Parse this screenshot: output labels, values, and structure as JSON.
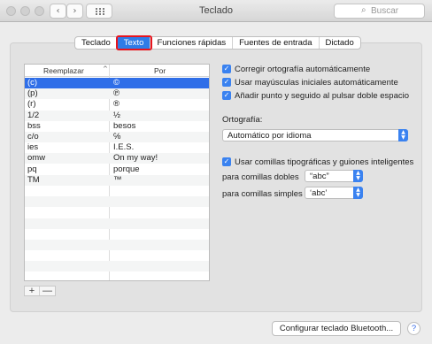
{
  "window": {
    "title": "Teclado",
    "back_glyph": "‹",
    "forward_glyph": "›",
    "search_icon_glyph": "⌕",
    "search_placeholder": "Buscar"
  },
  "tabs": [
    {
      "label": "Teclado",
      "selected": false
    },
    {
      "label": "Texto",
      "selected": true
    },
    {
      "label": "Funciones rápidas",
      "selected": false
    },
    {
      "label": "Fuentes de entrada",
      "selected": false
    },
    {
      "label": "Dictado",
      "selected": false
    }
  ],
  "table": {
    "col_replace": "Reemplazar",
    "col_with": "Por",
    "sort_glyph": "^",
    "rows": [
      {
        "replace": "(c)",
        "with": "©"
      },
      {
        "replace": "(p)",
        "with": "℗"
      },
      {
        "replace": "(r)",
        "with": "®"
      },
      {
        "replace": "1/2",
        "with": "½"
      },
      {
        "replace": "bss",
        "with": "besos"
      },
      {
        "replace": "c/o",
        "with": "℅"
      },
      {
        "replace": "ies",
        "with": "I.E.S."
      },
      {
        "replace": "omw",
        "with": "On my way!"
      },
      {
        "replace": "pq",
        "with": "porque"
      },
      {
        "replace": "TM",
        "with": "™"
      }
    ],
    "add_label": "+",
    "remove_label": "—"
  },
  "options": {
    "spelling_correct": {
      "label": "Corregir ortografía automáticamente",
      "checked": true
    },
    "capitalize": {
      "label": "Usar mayúsculas iniciales automáticamente",
      "checked": true
    },
    "period_double_space": {
      "label": "Añadir punto y seguido al pulsar doble espacio",
      "checked": true
    },
    "smart_quotes": {
      "label": "Usar comillas tipográficas y guiones inteligentes",
      "checked": true
    },
    "check_glyph": "✓"
  },
  "spelling": {
    "label": "Ortografía:",
    "value": "Automático por idioma"
  },
  "double_quotes": {
    "label": "para comillas dobles",
    "value": "“abc”"
  },
  "single_quotes": {
    "label": "para comillas simples",
    "value": "‘abc’"
  },
  "popup_arrows": {
    "up": "▲",
    "down": "▼"
  },
  "bluetooth_button": "Configurar teclado Bluetooth...",
  "help_label": "?"
}
